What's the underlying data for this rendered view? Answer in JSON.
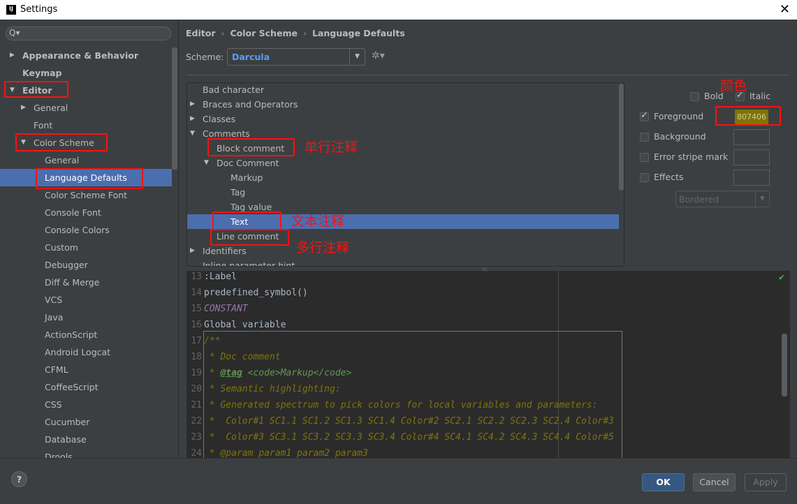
{
  "window": {
    "title": "Settings",
    "logo": "IJ",
    "close": "✕"
  },
  "sidebar": {
    "search_icon": "Q▾",
    "items": [
      {
        "label": "Appearance & Behavior",
        "indent": 0,
        "bold": true,
        "arrow": "▶"
      },
      {
        "label": "Keymap",
        "indent": 0,
        "bold": true
      },
      {
        "label": "Editor",
        "indent": 0,
        "bold": true,
        "arrow": "▼"
      },
      {
        "label": "General",
        "indent": 1,
        "arrow": "▶"
      },
      {
        "label": "Font",
        "indent": 1
      },
      {
        "label": "Color Scheme",
        "indent": 1,
        "arrow": "▼"
      },
      {
        "label": "General",
        "indent": 2
      },
      {
        "label": "Language Defaults",
        "indent": 2,
        "selected": true
      },
      {
        "label": "Color Scheme Font",
        "indent": 2
      },
      {
        "label": "Console Font",
        "indent": 2
      },
      {
        "label": "Console Colors",
        "indent": 2
      },
      {
        "label": "Custom",
        "indent": 2
      },
      {
        "label": "Debugger",
        "indent": 2
      },
      {
        "label": "Diff & Merge",
        "indent": 2
      },
      {
        "label": "VCS",
        "indent": 2
      },
      {
        "label": "Java",
        "indent": 2
      },
      {
        "label": "ActionScript",
        "indent": 2
      },
      {
        "label": "Android Logcat",
        "indent": 2
      },
      {
        "label": "CFML",
        "indent": 2
      },
      {
        "label": "CoffeeScript",
        "indent": 2
      },
      {
        "label": "CSS",
        "indent": 2
      },
      {
        "label": "Cucumber",
        "indent": 2
      },
      {
        "label": "Database",
        "indent": 2
      },
      {
        "label": "Drools",
        "indent": 2
      }
    ]
  },
  "breadcrumb": [
    "Editor",
    "Color Scheme",
    "Language Defaults"
  ],
  "breadcrumb_sep": "›",
  "scheme": {
    "label": "Scheme:",
    "value": "Darcula"
  },
  "tree": [
    {
      "label": "Bad character",
      "indent": 0
    },
    {
      "label": "Braces and Operators",
      "indent": 0,
      "arrow": "▶"
    },
    {
      "label": "Classes",
      "indent": 0,
      "arrow": "▶"
    },
    {
      "label": "Comments",
      "indent": 0,
      "arrow": "▼"
    },
    {
      "label": "Block comment",
      "indent": 1
    },
    {
      "label": "Doc Comment",
      "indent": 1,
      "arrow": "▼"
    },
    {
      "label": "Markup",
      "indent": 2
    },
    {
      "label": "Tag",
      "indent": 2
    },
    {
      "label": "Tag value",
      "indent": 2
    },
    {
      "label": "Text",
      "indent": 2,
      "selected": true
    },
    {
      "label": "Line comment",
      "indent": 1
    },
    {
      "label": "Identifiers",
      "indent": 0,
      "arrow": "▶"
    },
    {
      "label": "Inline parameter hint",
      "indent": 0
    }
  ],
  "props": {
    "bold": {
      "label": "Bold",
      "checked": false
    },
    "italic": {
      "label": "Italic",
      "checked": true
    },
    "foreground": {
      "label": "Foreground",
      "checked": true,
      "value": "807406"
    },
    "background": {
      "label": "Background",
      "checked": false
    },
    "error_stripe": {
      "label": "Error stripe mark",
      "checked": false
    },
    "effects": {
      "label": "Effects",
      "checked": false
    },
    "effect_type": "Bordered"
  },
  "annotations": {
    "color": "颜色",
    "single": "单行注释",
    "text": "文本注释",
    "multi": "多行注释"
  },
  "code": [
    {
      "n": "13",
      "s": [
        [
          "def",
          ":Label"
        ]
      ]
    },
    {
      "n": "14",
      "s": [
        [
          "def",
          "predefined_symbol()"
        ]
      ]
    },
    {
      "n": "15",
      "s": [
        [
          "const",
          "CONSTANT"
        ]
      ]
    },
    {
      "n": "16",
      "s": [
        [
          "def",
          "Global variable"
        ]
      ]
    },
    {
      "n": "17",
      "s": [
        [
          "doc",
          "/**"
        ]
      ]
    },
    {
      "n": "18",
      "s": [
        [
          "doc",
          " * Doc comment"
        ]
      ]
    },
    {
      "n": "19",
      "s": [
        [
          "doc",
          " * "
        ],
        [
          "tag",
          "@tag"
        ],
        [
          "doc",
          " "
        ],
        [
          "mk",
          "<code>Markup</code>"
        ]
      ]
    },
    {
      "n": "20",
      "s": [
        [
          "doc",
          " * Semantic highlighting:"
        ]
      ]
    },
    {
      "n": "21",
      "s": [
        [
          "doc",
          " * Generated spectrum to pick colors for local variables and parameters:"
        ]
      ]
    },
    {
      "n": "22",
      "s": [
        [
          "doc",
          " *  Color#1 SC1.1 SC1.2 SC1.3 SC1.4 Color#2 SC2.1 SC2.2 SC2.3 SC2.4 Color#3"
        ]
      ]
    },
    {
      "n": "23",
      "s": [
        [
          "doc",
          " *  Color#3 SC3.1 SC3.2 SC3.3 SC3.4 Color#4 SC4.1 SC4.2 SC4.3 SC4.4 Color#5"
        ]
      ]
    },
    {
      "n": "24",
      "s": [
        [
          "doc",
          " * @param param1 param2 param3"
        ]
      ]
    }
  ],
  "buttons": {
    "help": "?",
    "ok": "OK",
    "cancel": "Cancel",
    "apply": "Apply"
  },
  "colors": {
    "accent": "#4b6eaf",
    "foreground_swatch": "#807406",
    "annotation": "#ff1010"
  }
}
